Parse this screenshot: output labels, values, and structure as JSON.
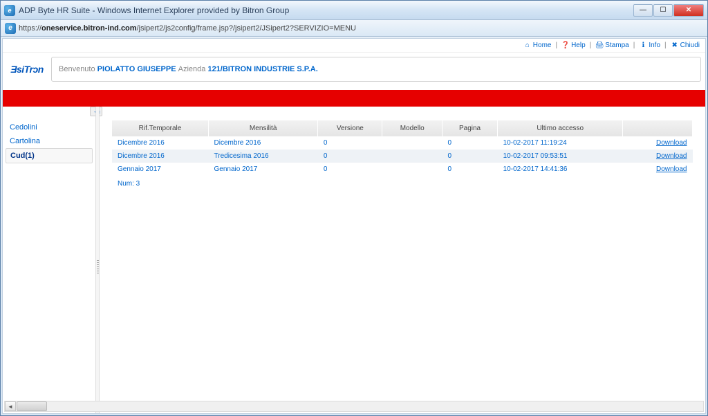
{
  "window": {
    "title": "ADP Byte HR Suite - Windows Internet Explorer provided by Bitron Group"
  },
  "address": {
    "proto": "https://",
    "domain": "oneservice.bitron-ind.com",
    "path": "/jsipert2/js2config/frame.jsp?/jsipert2/JSipert2?SERVIZIO=MENU"
  },
  "toplinks": {
    "home": "Home",
    "help": "Help",
    "stampa": "Stampa",
    "info": "Info",
    "chiudi": "Chiudi"
  },
  "logo_text": "ƎsiTrɔn",
  "welcome": {
    "benvenuto": "Benvenuto",
    "name": "PIOLATTO GIUSEPPE",
    "azienda_label": "Azienda",
    "company": "121/BITRON INDUSTRIE S.P.A."
  },
  "sidebar": {
    "items": [
      {
        "label": "Cedolini",
        "active": false
      },
      {
        "label": "Cartolina",
        "active": false
      },
      {
        "label": "Cud(1)",
        "active": true
      }
    ]
  },
  "table": {
    "headers": [
      "Rif.Temporale",
      "Mensilità",
      "Versione",
      "Modello",
      "Pagina",
      "Ultimo accesso",
      ""
    ],
    "rows": [
      {
        "rif": "Dicembre 2016",
        "mens": "Dicembre 2016",
        "ver": "0",
        "mod": "",
        "pag": "0",
        "acc": "10-02-2017 11:19:24",
        "dl": "Download"
      },
      {
        "rif": "Dicembre 2016",
        "mens": "Tredicesima 2016",
        "ver": "0",
        "mod": "",
        "pag": "0",
        "acc": "10-02-2017 09:53:51",
        "dl": "Download"
      },
      {
        "rif": "Gennaio 2017",
        "mens": "Gennaio 2017",
        "ver": "0",
        "mod": "",
        "pag": "0",
        "acc": "10-02-2017 14:41:36",
        "dl": "Download"
      }
    ],
    "footer": "Num: 3"
  }
}
